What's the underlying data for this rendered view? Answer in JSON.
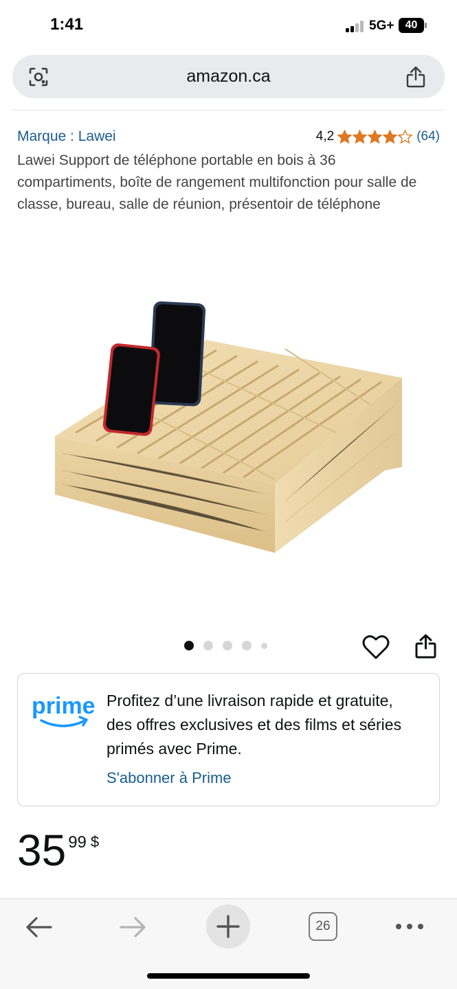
{
  "status_bar": {
    "time": "1:41",
    "network": "5G+",
    "battery": "40"
  },
  "browser": {
    "url": "amazon.ca",
    "open_tabs": "26"
  },
  "product": {
    "brand": "Marque : Lawei",
    "rating": "4,2",
    "rating_stars": 4.2,
    "rating_count": "(64)",
    "title": "Lawei Support de téléphone portable en bois à 36 compartiments, boîte de rangement multifonction pour salle de classe, bureau, salle de réunion, présentoir de téléphone",
    "image_count": 5,
    "active_image": 1
  },
  "prime": {
    "logo_text": "prime",
    "message": "Profitez d’une livraison rapide et gratuite, des offres exclusives et des films et séries primés avec Prime.",
    "cta": "S'abonner à Prime"
  },
  "price": {
    "whole": "35",
    "fraction": "99",
    "currency": "$"
  },
  "colors": {
    "link": "#1a5d8f",
    "star": "#de7921",
    "prime_blue": "#1a98ff"
  },
  "icons": [
    "camera-search-icon",
    "share-icon",
    "heart-icon",
    "back-arrow-icon",
    "forward-arrow-icon",
    "plus-icon",
    "more-icon"
  ]
}
